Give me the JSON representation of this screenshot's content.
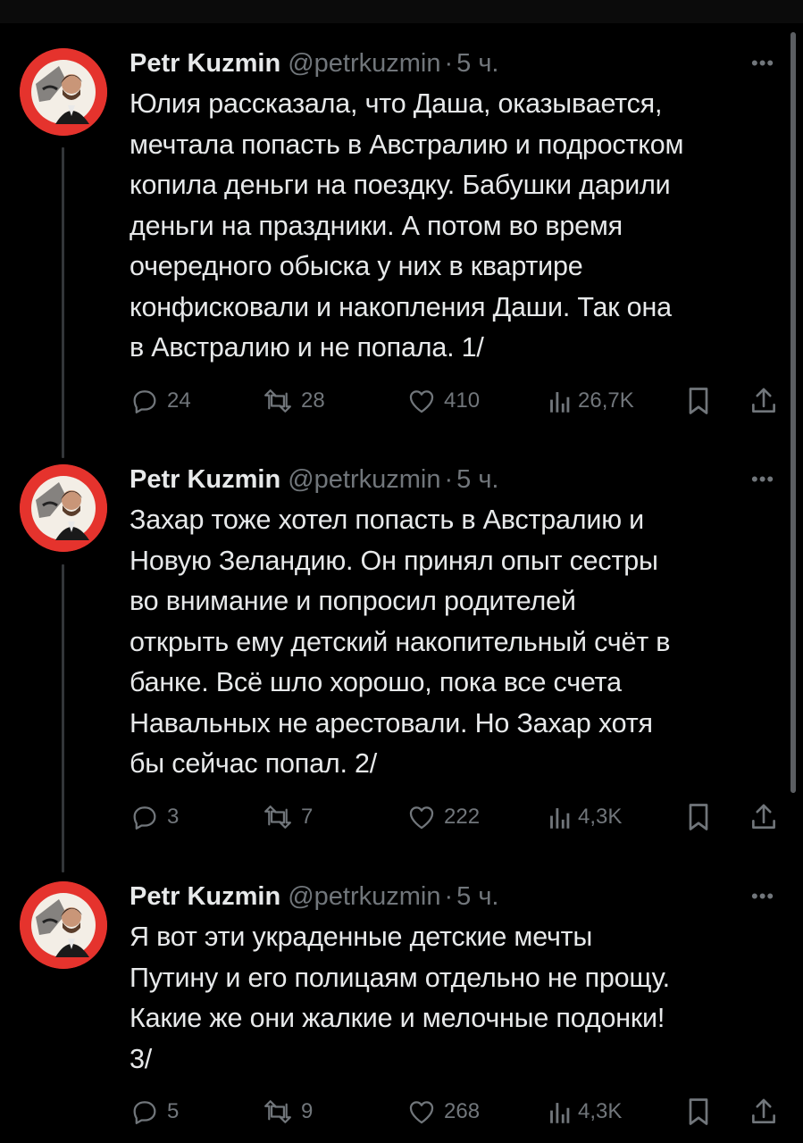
{
  "tweets": [
    {
      "author": "Petr Kuzmin",
      "handle": "@petrkuzmin",
      "separator": "·",
      "time": "5 ч.",
      "more": "•••",
      "text": "Юлия рассказала, что Даша, оказывается,\nмечтала попасть в Австралию и подростком\nкопила деньги на поездку. Бабушки дарили\nденьги на праздники. А потом во время\nочередного обыска у них в квартире\nконфисковали и накопления Даши. Так она\nв Австралию и не попала. 1/",
      "replies": "24",
      "retweets": "28",
      "likes": "410",
      "views": "26,7K"
    },
    {
      "author": "Petr Kuzmin",
      "handle": "@petrkuzmin",
      "separator": "·",
      "time": "5 ч.",
      "more": "•••",
      "text": "Захар тоже хотел попасть в Австралию и\nНовую Зеландию. Он принял опыт сестры\nво внимание и попросил родителей\nоткрыть ему детский накопительный счёт в\nбанке. Всё шло хорошо, пока все счета\nНавальных не арестовали. Но Захар хотя\nбы сейчас попал. 2/",
      "replies": "3",
      "retweets": "7",
      "likes": "222",
      "views": "4,3K"
    },
    {
      "author": "Petr Kuzmin",
      "handle": "@petrkuzmin",
      "separator": "·",
      "time": "5 ч.",
      "more": "•••",
      "text": "Я вот эти украденные детские мечты\nПутину и его полицаям отдельно не прощу.\nКакие же они жалкие и мелочные подонки!\n3/",
      "replies": "5",
      "retweets": "9",
      "likes": "268",
      "views": "4,3K"
    }
  ],
  "avatar_badge": {
    "top_text": "РОССИЯ",
    "arc_text": "БЕЗ ПУТИНА",
    "color": "#e5332d"
  },
  "colors": {
    "background": "#000000",
    "text": "#e7e9ea",
    "muted": "#71767b",
    "thread_line": "#333639"
  }
}
